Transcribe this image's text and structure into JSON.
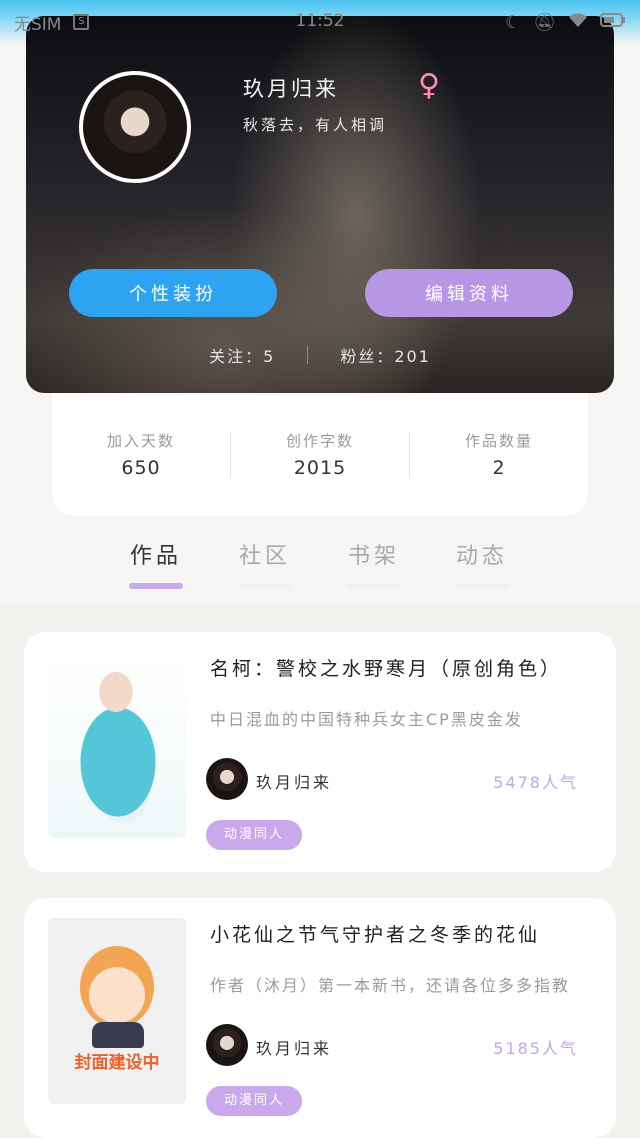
{
  "status_bar": {
    "carrier": "无SIM",
    "time": "11:52",
    "icons": [
      "sim-icon",
      "moon-icon",
      "mute-icon",
      "wifi-icon",
      "battery-icon"
    ]
  },
  "profile": {
    "username": "玖月归来",
    "gender_symbol": "♀",
    "signature": "秋落去，有人相调",
    "buttons": {
      "dress_up": "个性装扮",
      "edit_profile": "编辑资料"
    },
    "following_label": "关注：",
    "following": "5",
    "followers_label": "粉丝：",
    "followers": "201"
  },
  "stats": [
    {
      "label": "加入天数",
      "value": "650"
    },
    {
      "label": "创作字数",
      "value": "2015"
    },
    {
      "label": "作品数量",
      "value": "2"
    }
  ],
  "tabs": [
    {
      "label": "作品",
      "active": true
    },
    {
      "label": "社区",
      "active": false
    },
    {
      "label": "书架",
      "active": false
    },
    {
      "label": "动态",
      "active": false
    }
  ],
  "works": [
    {
      "title": "名柯：警校之水野寒月（原创角色）",
      "description": "中日混血的中国特种兵女主CP黑皮金发",
      "author": "玖月归来",
      "popularity": "5478人气",
      "tag": "动漫同人"
    },
    {
      "title": "小花仙之节气守护者之冬季的花仙",
      "description": "作者（沐月）第一本新书，还请各位多多指教",
      "author": "玖月归来",
      "popularity": "5185人气",
      "tag": "动漫同人",
      "cover_label": "封面建设中"
    }
  ],
  "colors": {
    "primary_blue": "#2ea3f2",
    "primary_purple": "#b896e6",
    "accent_purple": "#c9a8ec",
    "popularity": "#c2a6ea"
  }
}
